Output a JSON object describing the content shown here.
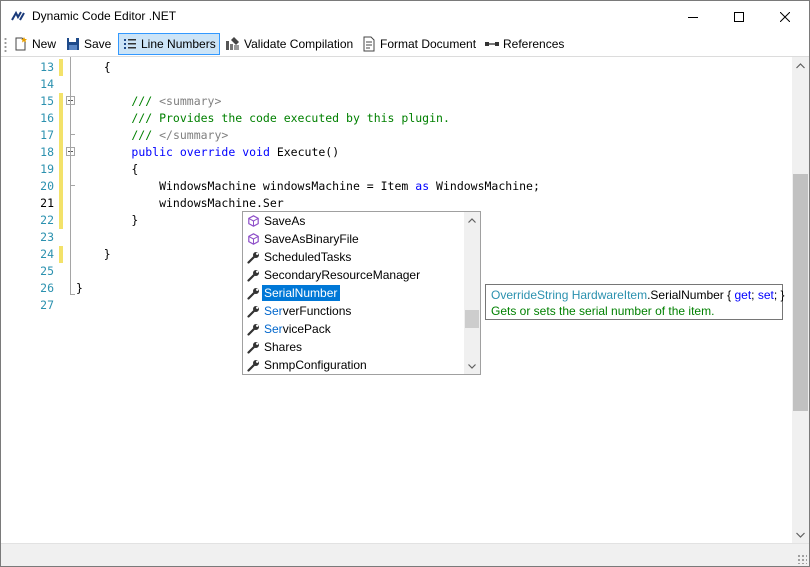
{
  "window": {
    "title": "Dynamic Code Editor .NET",
    "controls": [
      "minimize",
      "maximize",
      "close"
    ]
  },
  "toolbar": {
    "new_label": "New",
    "save_label": "Save",
    "line_numbers_label": "Line Numbers",
    "line_numbers_active": true,
    "validate_label": "Validate Compilation",
    "format_label": "Format Document",
    "references_label": "References"
  },
  "editor": {
    "current_line": 21,
    "lines": [
      {
        "n": "13",
        "parts": [
          {
            "t": "    {",
            "c": ""
          }
        ]
      },
      {
        "n": "14",
        "parts": []
      },
      {
        "n": "15",
        "parts": [
          {
            "t": "        /// ",
            "c": "cm"
          },
          {
            "t": "<summary>",
            "c": "cmx"
          }
        ]
      },
      {
        "n": "16",
        "parts": [
          {
            "t": "        /// Provides the code executed by this plugin.",
            "c": "cm"
          }
        ]
      },
      {
        "n": "17",
        "parts": [
          {
            "t": "        /// ",
            "c": "cm"
          },
          {
            "t": "</summary>",
            "c": "cmx"
          }
        ]
      },
      {
        "n": "18",
        "parts": [
          {
            "t": "        ",
            "c": ""
          },
          {
            "t": "public",
            "c": "kw"
          },
          {
            "t": " ",
            "c": ""
          },
          {
            "t": "override",
            "c": "kw"
          },
          {
            "t": " ",
            "c": ""
          },
          {
            "t": "void",
            "c": "kw"
          },
          {
            "t": " Execute()",
            "c": ""
          }
        ]
      },
      {
        "n": "19",
        "parts": [
          {
            "t": "        {",
            "c": ""
          }
        ]
      },
      {
        "n": "20",
        "parts": [
          {
            "t": "            WindowsMachine windowsMachine = Item ",
            "c": ""
          },
          {
            "t": "as",
            "c": "kw"
          },
          {
            "t": " WindowsMachine;",
            "c": ""
          }
        ]
      },
      {
        "n": "21",
        "parts": [
          {
            "t": "            windowsMachine.Ser",
            "c": ""
          }
        ]
      },
      {
        "n": "22",
        "parts": [
          {
            "t": "        }",
            "c": ""
          }
        ]
      },
      {
        "n": "23",
        "parts": []
      },
      {
        "n": "24",
        "parts": [
          {
            "t": "    }",
            "c": ""
          }
        ]
      },
      {
        "n": "25",
        "parts": []
      },
      {
        "n": "26",
        "parts": [
          {
            "t": "}",
            "c": ""
          }
        ]
      },
      {
        "n": "27",
        "parts": []
      }
    ]
  },
  "completion": {
    "typed_prefix": "Ser",
    "selected_index": 4,
    "items": [
      {
        "label": "SaveAs",
        "icon": "method-icon"
      },
      {
        "label": "SaveAsBinaryFile",
        "icon": "method-icon"
      },
      {
        "label": "ScheduledTasks",
        "icon": "property-icon"
      },
      {
        "label": "SecondaryResourceManager",
        "icon": "property-icon"
      },
      {
        "label": "SerialNumber",
        "icon": "property-icon"
      },
      {
        "label": "ServerFunctions",
        "icon": "property-icon",
        "match": "Ser",
        "rest": "verFunctions"
      },
      {
        "label": "ServicePack",
        "icon": "property-icon",
        "match": "Ser",
        "rest": "vicePack"
      },
      {
        "label": "Shares",
        "icon": "property-icon"
      },
      {
        "label": "SnmpConfiguration",
        "icon": "property-icon"
      }
    ]
  },
  "tooltip": {
    "type": "OverrideString",
    "class": "HardwareItem",
    "dot": ".",
    "member": "SerialNumber",
    "open": " { ",
    "get": "get",
    "sep1": "; ",
    "set": "set",
    "close": "; }",
    "description": "Gets or sets the serial number of the item."
  },
  "colors": {
    "keyword": "#0000ff",
    "comment": "#008000",
    "line_number": "#2b91af",
    "selection": "#0078d7",
    "change_marker": "#f3e26a"
  }
}
